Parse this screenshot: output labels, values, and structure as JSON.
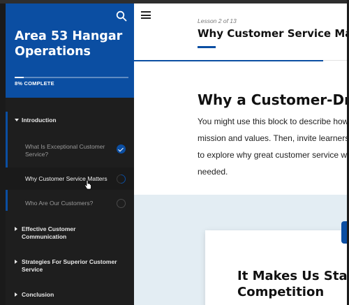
{
  "sidebar": {
    "course_title_line1": "Area 53 Hangar",
    "course_title_line2": "Operations",
    "progress_label": "8% COMPLETE",
    "progress_fraction": 0.08,
    "sections": [
      {
        "title": "Introduction",
        "expanded": true,
        "lessons": [
          {
            "title_line1": "What Is Exceptional Customer",
            "title_line2": "Service?",
            "status": "complete"
          },
          {
            "title_line1": "Why Customer Service Matters",
            "status": "in-progress"
          },
          {
            "title_line1": "Who Are Our Customers?",
            "status": "not-started"
          }
        ]
      },
      {
        "title_line1": "Effective Customer",
        "title_line2": "Communication",
        "expanded": false
      },
      {
        "title_line1": "Strategies For Superior Customer",
        "title_line2": "Service",
        "expanded": false
      },
      {
        "title": "Conclusion",
        "expanded": false
      }
    ]
  },
  "header": {
    "lesson_count": "Lesson 2 of 13",
    "lesson_title": "Why Customer Service Matte"
  },
  "content": {
    "heading": "Why a Customer-Driv",
    "body_lines": [
      "You might use this block to describe how",
      "mission and values. Then, invite learners",
      "to explore why great customer service wi",
      "needed."
    ],
    "card_heading_line1": "It Makes Us Stand",
    "card_heading_line2": "Competition"
  },
  "colors": {
    "brand_blue": "#0b4ea2",
    "sidebar_bg": "#1e1e1e",
    "lower_band_bg": "#e3edf3"
  }
}
